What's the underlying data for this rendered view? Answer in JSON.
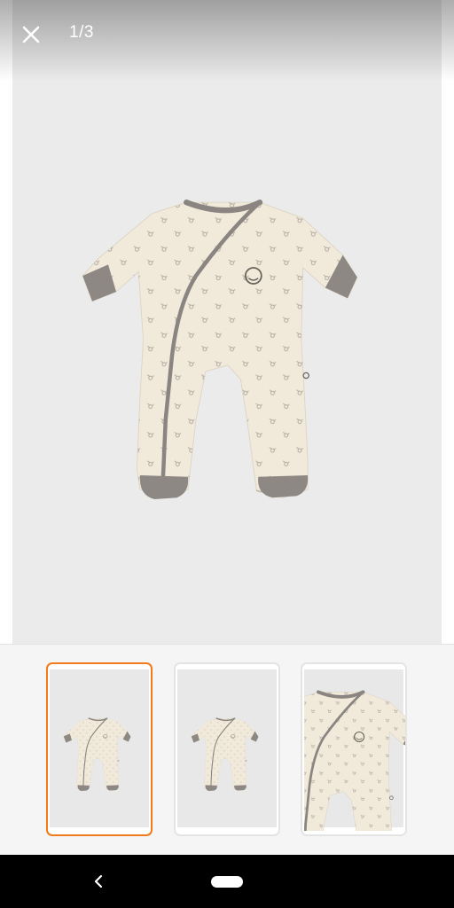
{
  "viewer": {
    "counter": "1/3",
    "close_icon": "close-icon",
    "image_subject": "onesie-front",
    "colors": {
      "fabric": "#f1eadb",
      "trim": "#8a8580",
      "background": "#ebebec"
    }
  },
  "thumbnails": [
    {
      "subject": "onesie-front",
      "selected": true
    },
    {
      "subject": "onesie-back",
      "selected": false
    },
    {
      "subject": "onesie-detail",
      "selected": false
    }
  ],
  "accent_color": "#f07a1c",
  "navbar": {
    "back_icon": "back-chevron-icon",
    "home_icon": "home-pill-icon"
  }
}
